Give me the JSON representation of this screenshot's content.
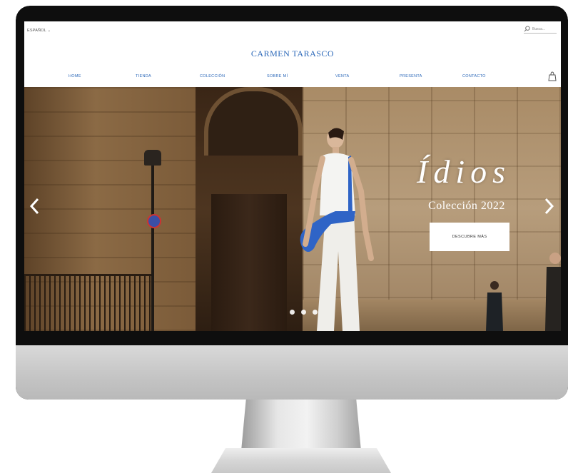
{
  "site": {
    "language": "ESPAÑOL ⌄",
    "search_placeholder": "Busca...",
    "brand": "CARMEN TARASCO"
  },
  "nav": [
    {
      "label": "HOME"
    },
    {
      "label": "TIENDA"
    },
    {
      "label": "COLECCIÓN"
    },
    {
      "label": "SOBRE MÍ"
    },
    {
      "label": "VENTA"
    },
    {
      "label": "PRESENTA"
    },
    {
      "label": "CONTACTO"
    }
  ],
  "hero": {
    "script_title": "Ídios",
    "subtitle": "Colección 2022",
    "cta_label": "DESCUBRE MÁS",
    "slide_count": 3
  },
  "colors": {
    "brand_blue": "#2a67b8",
    "garment_blue": "#2f64c6"
  },
  "icons": [
    "search-icon",
    "cart-icon",
    "chevron-left-icon",
    "chevron-right-icon"
  ]
}
